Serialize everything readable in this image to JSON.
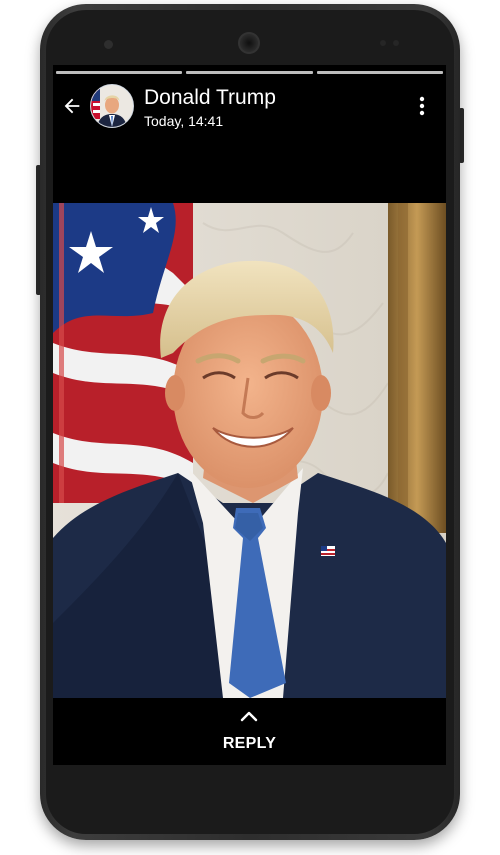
{
  "story": {
    "progress_segments": 3,
    "contact_name": "Donald Trump",
    "timestamp": "Today, 14:41",
    "reply_label": "REPLY"
  },
  "icons": {
    "back": "arrow-left-icon",
    "menu": "more-vert-icon",
    "reply_chevron": "chevron-up-icon"
  },
  "colors": {
    "screen_background": "#000000",
    "header_text": "#ffffff",
    "progress_bar": "#bdbdbd",
    "device_body": "#2e2e2e"
  }
}
